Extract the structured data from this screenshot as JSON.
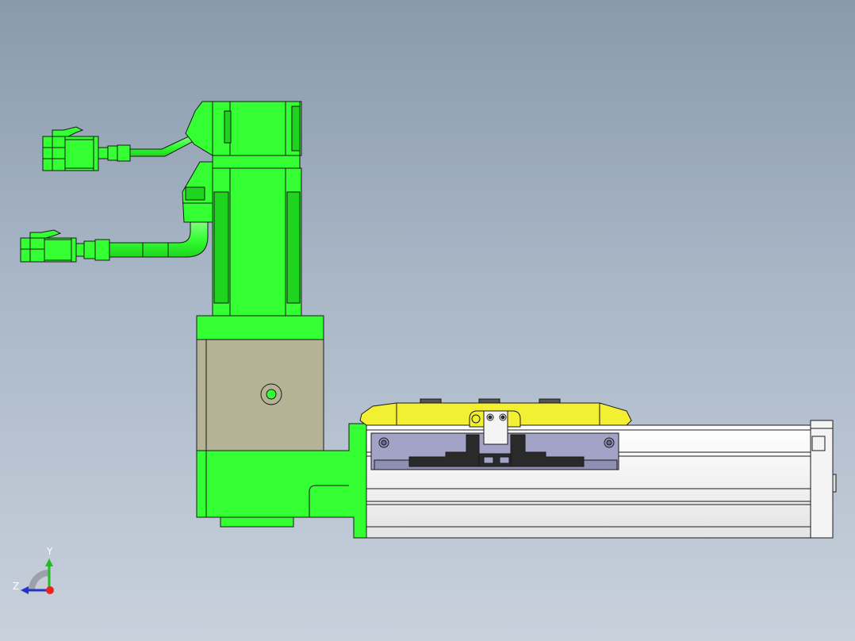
{
  "viewport": {
    "background_top": "#8a9aac",
    "background_bottom": "#c8d1dc"
  },
  "model": {
    "components": [
      "motor-top-connector-cable",
      "motor-bottom-connector-cable",
      "servo-motor",
      "gear-reducer",
      "motor-mount-bracket",
      "linear-actuator-rail",
      "slide-carriage-table"
    ],
    "colors": {
      "motor_green": "#33ff33",
      "reducer_khaki": "#b5b396",
      "table_yellow": "#f3ef33",
      "carriage_lavender": "#a3a3c8",
      "rail_white": "#f4f4f4",
      "edge_dark": "#1a1a1a"
    }
  },
  "triad": {
    "y_label": "Y",
    "z_label": "Z",
    "y_color": "#22bb22",
    "z_color": "#2233cc",
    "x_color": "#ee2222"
  }
}
